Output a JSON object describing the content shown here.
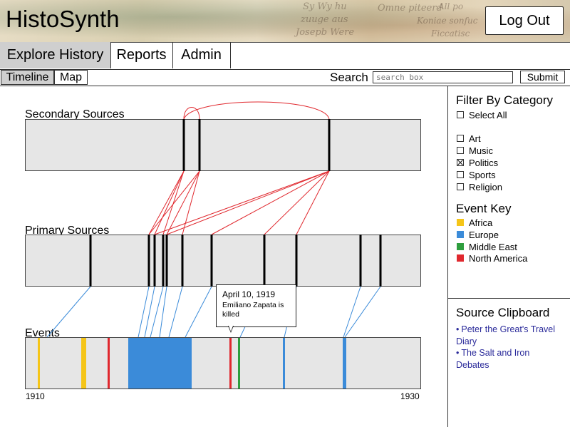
{
  "app": {
    "title": "HistoSynth",
    "logout_label": "Log Out"
  },
  "nav": {
    "tabs": [
      "Explore History",
      "Reports",
      "Admin"
    ],
    "active": "Explore History"
  },
  "subnav": {
    "tabs": [
      "Timeline",
      "Map"
    ],
    "active": "Timeline"
  },
  "search": {
    "label": "Search",
    "placeholder": "search box",
    "submit_label": "Submit"
  },
  "filter": {
    "heading": "Filter By Category",
    "select_all": {
      "label": "Select All",
      "checked": false
    },
    "categories": [
      {
        "label": "Art",
        "checked": false
      },
      {
        "label": "Music",
        "checked": false
      },
      {
        "label": "Politics",
        "checked": true
      },
      {
        "label": "Sports",
        "checked": false
      },
      {
        "label": "Religion",
        "checked": false
      }
    ]
  },
  "event_key": {
    "heading": "Event Key",
    "items": [
      {
        "label": "Africa",
        "color": "#f5c518"
      },
      {
        "label": "Europe",
        "color": "#3b8bd9"
      },
      {
        "label": "Middle East",
        "color": "#2e9e3e"
      },
      {
        "label": "North America",
        "color": "#e0282e"
      }
    ]
  },
  "clipboard": {
    "heading": "Source Clipboard",
    "items": [
      "Peter the Great's Travel Diary",
      "The Salt and Iron Debates"
    ]
  },
  "timeline": {
    "secondary_label": "Secondary Sources",
    "primary_label": "Primary Sources",
    "events_label": "Events",
    "start_year": "1910",
    "end_year": "1930",
    "callout": {
      "date": "April 10, 1919",
      "description": "Emiliano Zapata is killed"
    }
  },
  "header_decor": [
    "Sy Wy hu",
    "zuuge aus",
    "Josepb Were",
    "Omne piteerd",
    "Koniae sonfuc",
    "Ficcatisc",
    "All po"
  ]
}
